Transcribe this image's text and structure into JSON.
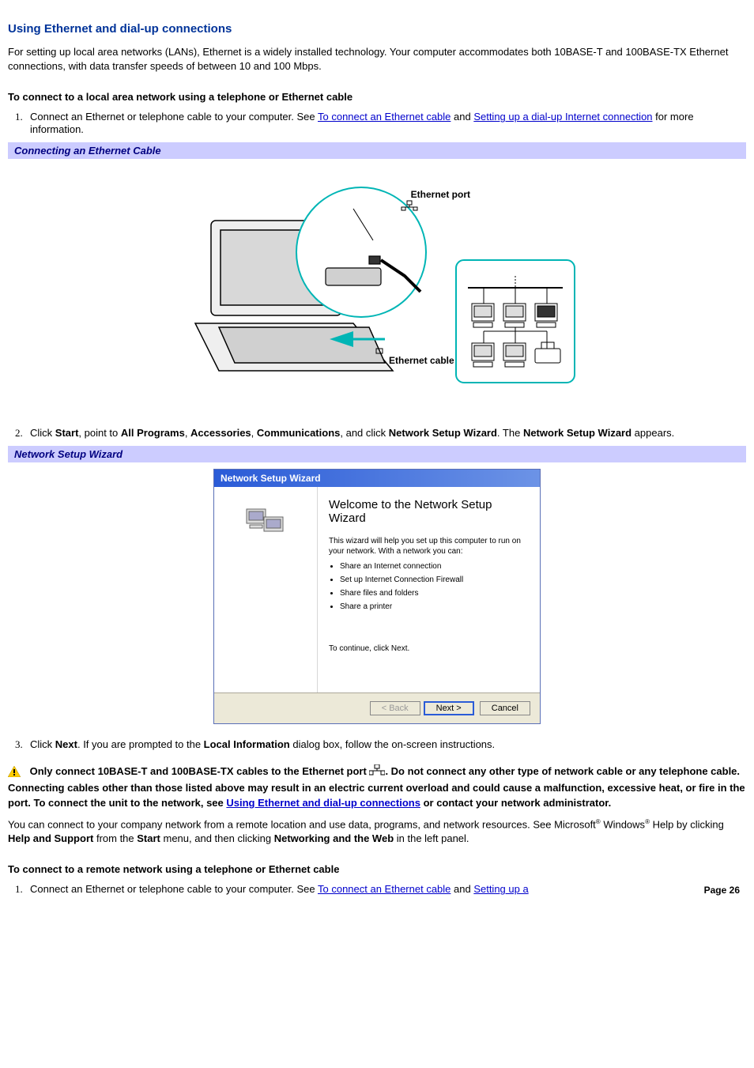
{
  "heading": "Using Ethernet and dial-up connections",
  "intro": "For setting up local area networks (LANs), Ethernet is a widely installed technology. Your computer accommodates both 10BASE-T and 100BASE-TX Ethernet connections, with data transfer speeds of between 10 and 100 Mbps.",
  "subheading_local": "To connect to a local area network using a telephone or Ethernet cable",
  "step1_prefix": "Connect an Ethernet or telephone cable to your computer. See ",
  "link_connect_ethernet": "To connect an Ethernet cable",
  "step1_mid": " and ",
  "link_dialup": "Setting up a dial-up Internet connection",
  "step1_suffix": " for more information.",
  "caption_ethernet": "Connecting an Ethernet Cable",
  "fig_labels": {
    "port": "Ethernet port",
    "cable": "Ethernet cable"
  },
  "step2_parts": {
    "a": "Click ",
    "start": "Start",
    "b": ", point to ",
    "allprog": "All Programs",
    "c": ", ",
    "acc": "Accessories",
    "d": ", ",
    "comm": "Communications",
    "e": ", and click ",
    "nsw": "Network Setup Wizard",
    "f": ". The ",
    "nsw2": "Network Setup Wizard",
    "g": " appears."
  },
  "caption_wizard": "Network Setup Wizard",
  "wizard": {
    "title": "Network Setup Wizard",
    "welcome": "Welcome to the Network Setup Wizard",
    "intro": "This wizard will help you set up this computer to run on your network. With a network you can:",
    "bullets": [
      "Share an Internet connection",
      "Set up Internet Connection Firewall",
      "Share files and folders",
      "Share a printer"
    ],
    "continue": "To continue, click Next.",
    "back": "< Back",
    "next": "Next >",
    "cancel": "Cancel"
  },
  "step3_parts": {
    "a": "Click ",
    "next": "Next",
    "b": ". If you are prompted to the ",
    "local": "Local Information",
    "c": " dialog box, follow the on-screen instructions."
  },
  "warning": {
    "a": "Only connect 10BASE-T and 100BASE-TX cables to the Ethernet port ",
    "b": ". Do not connect any other type of network cable or any telephone cable. Connecting cables other than those listed above may result in an electric current overload and could cause a malfunction, excessive heat, or fire in the port. To connect the unit to the network, see ",
    "link": "Using Ethernet and dial-up connections",
    "c": " or contact your network administrator."
  },
  "remote_para": {
    "a": "You can connect to your company network from a remote location and use data, programs, and network resources. See Microsoft",
    "b": " Windows",
    "c": " Help by clicking ",
    "helpsupport": "Help and Support",
    "d": " from the ",
    "start": "Start",
    "e": " menu, and then clicking ",
    "netweb": "Networking and the Web",
    "f": " in the left panel."
  },
  "subheading_remote": "To connect to a remote network using a telephone or Ethernet cable",
  "remote_step1_prefix": "Connect an Ethernet or telephone cable to your computer. See ",
  "remote_step1_mid": " and ",
  "remote_step1_link2": "Setting up a",
  "page_number": "Page 26"
}
